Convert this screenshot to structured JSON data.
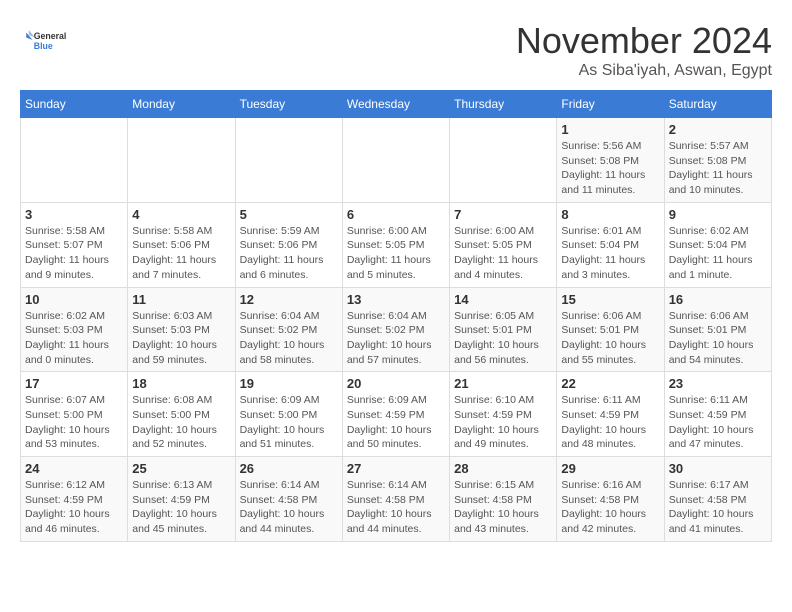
{
  "logo": {
    "general": "General",
    "blue": "Blue"
  },
  "header": {
    "month": "November 2024",
    "location": "As Siba'iyah, Aswan, Egypt"
  },
  "weekdays": [
    "Sunday",
    "Monday",
    "Tuesday",
    "Wednesday",
    "Thursday",
    "Friday",
    "Saturday"
  ],
  "weeks": [
    [
      {
        "day": "",
        "info": ""
      },
      {
        "day": "",
        "info": ""
      },
      {
        "day": "",
        "info": ""
      },
      {
        "day": "",
        "info": ""
      },
      {
        "day": "",
        "info": ""
      },
      {
        "day": "1",
        "info": "Sunrise: 5:56 AM\nSunset: 5:08 PM\nDaylight: 11 hours and 11 minutes."
      },
      {
        "day": "2",
        "info": "Sunrise: 5:57 AM\nSunset: 5:08 PM\nDaylight: 11 hours and 10 minutes."
      }
    ],
    [
      {
        "day": "3",
        "info": "Sunrise: 5:58 AM\nSunset: 5:07 PM\nDaylight: 11 hours and 9 minutes."
      },
      {
        "day": "4",
        "info": "Sunrise: 5:58 AM\nSunset: 5:06 PM\nDaylight: 11 hours and 7 minutes."
      },
      {
        "day": "5",
        "info": "Sunrise: 5:59 AM\nSunset: 5:06 PM\nDaylight: 11 hours and 6 minutes."
      },
      {
        "day": "6",
        "info": "Sunrise: 6:00 AM\nSunset: 5:05 PM\nDaylight: 11 hours and 5 minutes."
      },
      {
        "day": "7",
        "info": "Sunrise: 6:00 AM\nSunset: 5:05 PM\nDaylight: 11 hours and 4 minutes."
      },
      {
        "day": "8",
        "info": "Sunrise: 6:01 AM\nSunset: 5:04 PM\nDaylight: 11 hours and 3 minutes."
      },
      {
        "day": "9",
        "info": "Sunrise: 6:02 AM\nSunset: 5:04 PM\nDaylight: 11 hours and 1 minute."
      }
    ],
    [
      {
        "day": "10",
        "info": "Sunrise: 6:02 AM\nSunset: 5:03 PM\nDaylight: 11 hours and 0 minutes."
      },
      {
        "day": "11",
        "info": "Sunrise: 6:03 AM\nSunset: 5:03 PM\nDaylight: 10 hours and 59 minutes."
      },
      {
        "day": "12",
        "info": "Sunrise: 6:04 AM\nSunset: 5:02 PM\nDaylight: 10 hours and 58 minutes."
      },
      {
        "day": "13",
        "info": "Sunrise: 6:04 AM\nSunset: 5:02 PM\nDaylight: 10 hours and 57 minutes."
      },
      {
        "day": "14",
        "info": "Sunrise: 6:05 AM\nSunset: 5:01 PM\nDaylight: 10 hours and 56 minutes."
      },
      {
        "day": "15",
        "info": "Sunrise: 6:06 AM\nSunset: 5:01 PM\nDaylight: 10 hours and 55 minutes."
      },
      {
        "day": "16",
        "info": "Sunrise: 6:06 AM\nSunset: 5:01 PM\nDaylight: 10 hours and 54 minutes."
      }
    ],
    [
      {
        "day": "17",
        "info": "Sunrise: 6:07 AM\nSunset: 5:00 PM\nDaylight: 10 hours and 53 minutes."
      },
      {
        "day": "18",
        "info": "Sunrise: 6:08 AM\nSunset: 5:00 PM\nDaylight: 10 hours and 52 minutes."
      },
      {
        "day": "19",
        "info": "Sunrise: 6:09 AM\nSunset: 5:00 PM\nDaylight: 10 hours and 51 minutes."
      },
      {
        "day": "20",
        "info": "Sunrise: 6:09 AM\nSunset: 4:59 PM\nDaylight: 10 hours and 50 minutes."
      },
      {
        "day": "21",
        "info": "Sunrise: 6:10 AM\nSunset: 4:59 PM\nDaylight: 10 hours and 49 minutes."
      },
      {
        "day": "22",
        "info": "Sunrise: 6:11 AM\nSunset: 4:59 PM\nDaylight: 10 hours and 48 minutes."
      },
      {
        "day": "23",
        "info": "Sunrise: 6:11 AM\nSunset: 4:59 PM\nDaylight: 10 hours and 47 minutes."
      }
    ],
    [
      {
        "day": "24",
        "info": "Sunrise: 6:12 AM\nSunset: 4:59 PM\nDaylight: 10 hours and 46 minutes."
      },
      {
        "day": "25",
        "info": "Sunrise: 6:13 AM\nSunset: 4:59 PM\nDaylight: 10 hours and 45 minutes."
      },
      {
        "day": "26",
        "info": "Sunrise: 6:14 AM\nSunset: 4:58 PM\nDaylight: 10 hours and 44 minutes."
      },
      {
        "day": "27",
        "info": "Sunrise: 6:14 AM\nSunset: 4:58 PM\nDaylight: 10 hours and 44 minutes."
      },
      {
        "day": "28",
        "info": "Sunrise: 6:15 AM\nSunset: 4:58 PM\nDaylight: 10 hours and 43 minutes."
      },
      {
        "day": "29",
        "info": "Sunrise: 6:16 AM\nSunset: 4:58 PM\nDaylight: 10 hours and 42 minutes."
      },
      {
        "day": "30",
        "info": "Sunrise: 6:17 AM\nSunset: 4:58 PM\nDaylight: 10 hours and 41 minutes."
      }
    ]
  ]
}
